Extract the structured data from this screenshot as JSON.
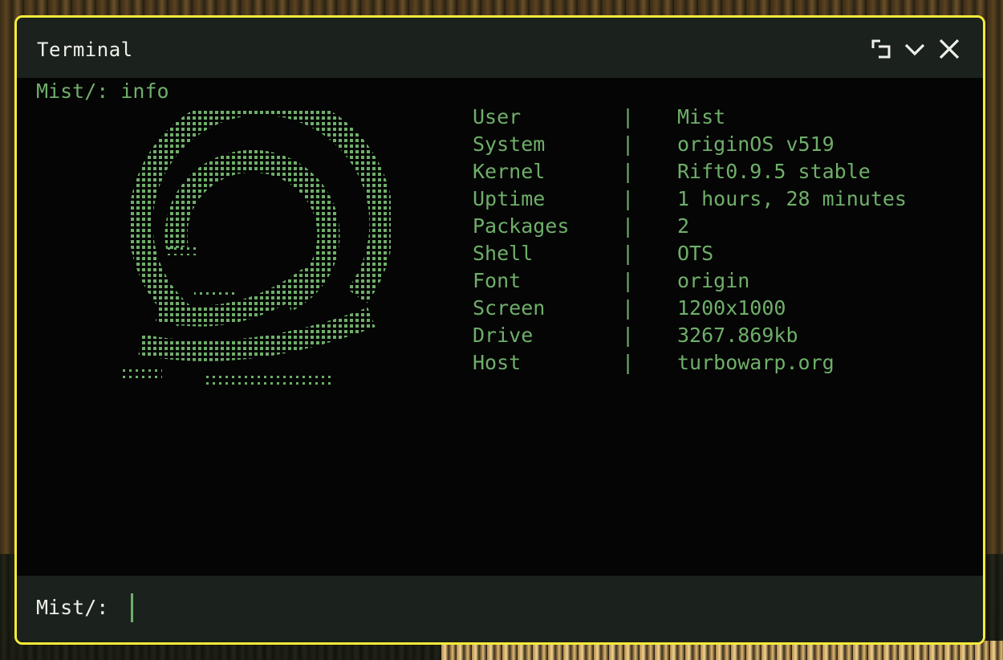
{
  "window": {
    "title": "Terminal",
    "accent_border": "#f5ea3a",
    "controls": [
      {
        "name": "maximize-icon"
      },
      {
        "name": "chevron-down-icon"
      },
      {
        "name": "close-icon"
      }
    ]
  },
  "terminal": {
    "prompt": "Mist/:",
    "last_command": "info",
    "text_color": "#6fae6a",
    "logo": "origin-ascii-logo"
  },
  "info": [
    {
      "key": "User",
      "value": "Mist"
    },
    {
      "key": "System",
      "value": "originOS v519"
    },
    {
      "key": "Kernel",
      "value": "Rift0.9.5 stable"
    },
    {
      "key": "Uptime",
      "value": "1 hours, 28 minutes"
    },
    {
      "key": "Packages",
      "value": "2"
    },
    {
      "key": "Shell",
      "value": "OTS"
    },
    {
      "key": "Font",
      "value": "origin"
    },
    {
      "key": "Screen",
      "value": "1200x1000"
    },
    {
      "key": "Drive",
      "value": "3267.869kb"
    },
    {
      "key": "Host",
      "value": "turbowarp.org"
    }
  ],
  "info_separator": "|",
  "input": {
    "prompt": "Mist/:",
    "value": ""
  }
}
